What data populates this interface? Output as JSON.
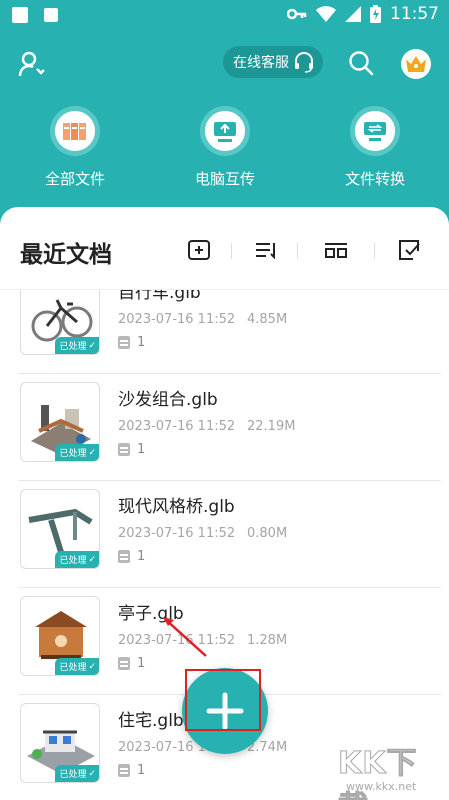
{
  "status_bar": {
    "time": "11:57"
  },
  "header": {
    "service_label": "在线客服"
  },
  "features": [
    {
      "label": "全部文件",
      "icon": "folder-files-icon"
    },
    {
      "label": "电脑互传",
      "icon": "pc-transfer-icon"
    },
    {
      "label": "文件转换",
      "icon": "convert-icon"
    }
  ],
  "recent": {
    "title": "最近文档"
  },
  "files": [
    {
      "name": "自行车.glb",
      "date": "2023-07-16 11:52",
      "size": "4.85M",
      "pages": "1",
      "badge": "已处理"
    },
    {
      "name": "沙发组合.glb",
      "date": "2023-07-16 11:52",
      "size": "22.19M",
      "pages": "1",
      "badge": "已处理"
    },
    {
      "name": "现代风格桥.glb",
      "date": "2023-07-16 11:52",
      "size": "0.80M",
      "pages": "1",
      "badge": "已处理"
    },
    {
      "name": "亭子.glb",
      "date": "2023-07-16 11:52",
      "size": "1.28M",
      "pages": "1",
      "badge": "已处理"
    },
    {
      "name": "住宅.glb",
      "date": "2023-07-16 11:52",
      "size": "2.74M",
      "pages": "1",
      "badge": "已处理"
    }
  ],
  "watermark": {
    "text": "KK下载",
    "url": "www.kkx.net"
  },
  "colors": {
    "primary": "#27b1b0",
    "highlight": "#e02020"
  }
}
